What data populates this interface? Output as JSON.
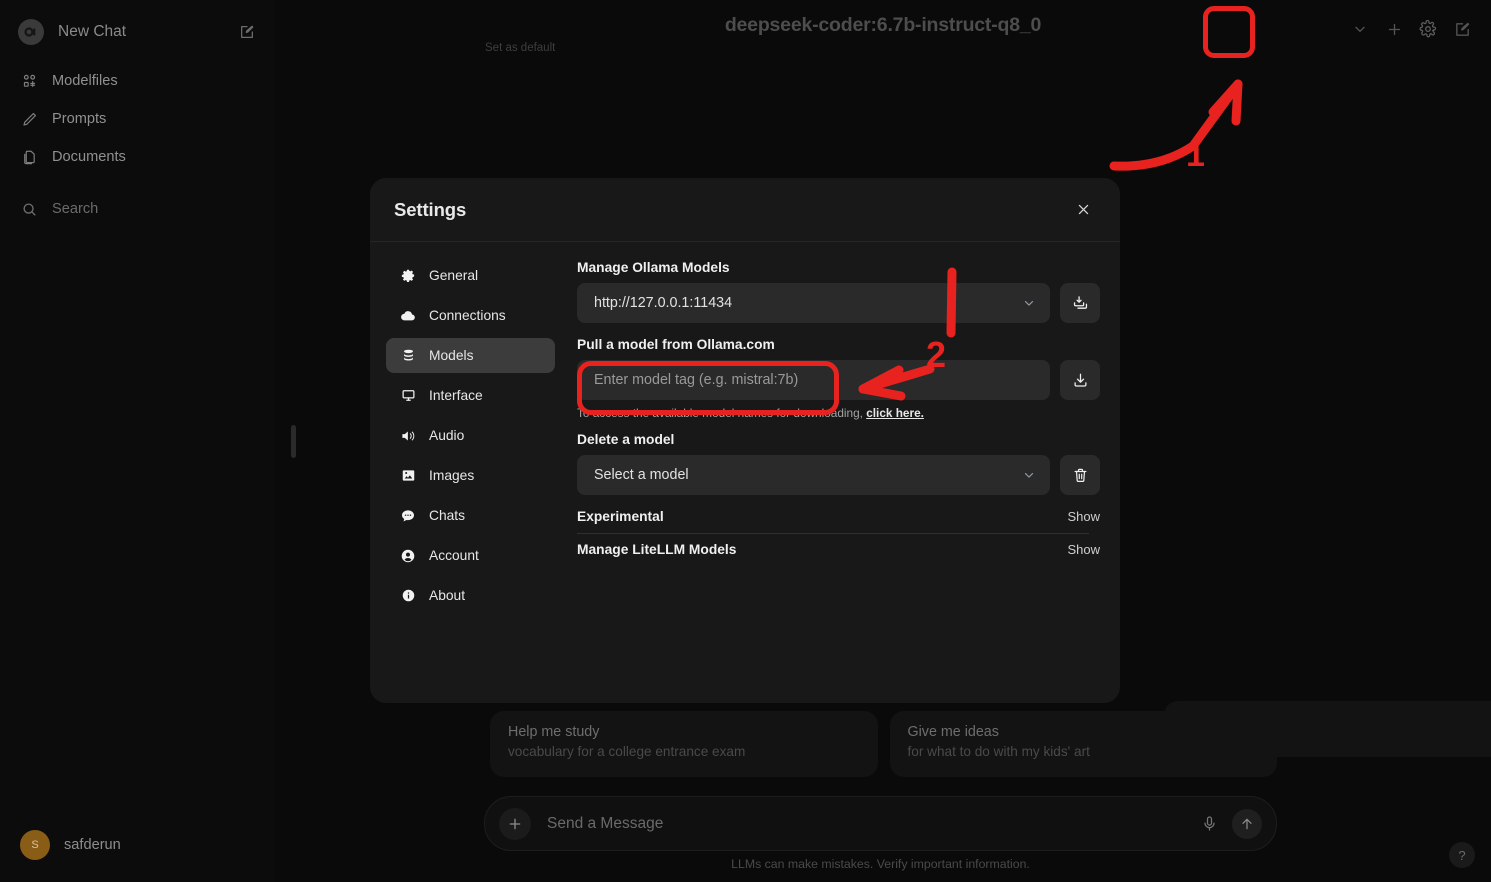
{
  "sidebar": {
    "new_chat": {
      "label": "New Chat",
      "logo_alt": "openwebui-logo",
      "edit_icon": "edit-square-icon"
    },
    "items": [
      {
        "label": "Modelfiles",
        "icon": "modelfiles-icon"
      },
      {
        "label": "Prompts",
        "icon": "pencil-icon"
      },
      {
        "label": "Documents",
        "icon": "documents-icon"
      }
    ],
    "search": {
      "label": "Search",
      "icon": "search-icon"
    },
    "user": {
      "name": "safderun",
      "initial": "S",
      "avatar_color": "#8a5d16"
    }
  },
  "topbar": {
    "model_title": "deepseek-coder:6.7b-instruct-q8_0",
    "set_as_default": "Set as default",
    "buttons": [
      {
        "name": "chevron-down-icon"
      },
      {
        "name": "plus-icon"
      },
      {
        "name": "gear-icon"
      },
      {
        "name": "edit-square-icon"
      }
    ]
  },
  "annotations": {
    "marker_color": "#e8231f",
    "items": [
      {
        "label": "1",
        "target": "settings-gear-button"
      },
      {
        "label": "2",
        "target": "model-tag-input"
      }
    ]
  },
  "settings_modal": {
    "title": "Settings",
    "close_icon": "close-icon",
    "nav": [
      {
        "label": "General",
        "icon": "gear-icon",
        "active": false
      },
      {
        "label": "Connections",
        "icon": "cloud-icon",
        "active": false
      },
      {
        "label": "Models",
        "icon": "database-stack-icon",
        "active": true
      },
      {
        "label": "Interface",
        "icon": "monitor-icon",
        "active": false
      },
      {
        "label": "Audio",
        "icon": "speaker-icon",
        "active": false
      },
      {
        "label": "Images",
        "icon": "image-icon",
        "active": false
      },
      {
        "label": "Chats",
        "icon": "chat-bubble-icon",
        "active": false
      },
      {
        "label": "Account",
        "icon": "user-circle-icon",
        "active": false
      },
      {
        "label": "About",
        "icon": "info-circle-icon",
        "active": false
      }
    ],
    "models_panel": {
      "manage_ollama_label": "Manage Ollama Models",
      "ollama_url_value": "http://127.0.0.1:11434",
      "ollama_sync_button": "download-all-icon",
      "pull_model_label": "Pull a model from Ollama.com",
      "pull_model_placeholder": "Enter model tag (e.g. mistral:7b)",
      "pull_model_value": "",
      "pull_download_button": "download-icon",
      "hint_text": "To access the available model names for downloading,",
      "hint_link": "click here.",
      "delete_model_label": "Delete a model",
      "delete_model_value": "Select a model",
      "delete_button": "trash-icon",
      "sections": [
        {
          "title": "Experimental",
          "action": "Show"
        },
        {
          "title": "Manage LiteLLM Models",
          "action": "Show"
        }
      ]
    }
  },
  "chat": {
    "suggestions": [
      {
        "title": "Help me study",
        "subtitle": "vocabulary for a college entrance exam"
      },
      {
        "title": "Give me ideas",
        "subtitle": "for what to do with my kids' art"
      }
    ],
    "composer": {
      "placeholder": "Send a Message",
      "value": "",
      "plus_icon": "plus-icon",
      "mic_icon": "microphone-icon",
      "send_icon": "arrow-up-icon"
    },
    "disclaimer": "LLMs can make mistakes. Verify important information.",
    "help_label": "?"
  }
}
